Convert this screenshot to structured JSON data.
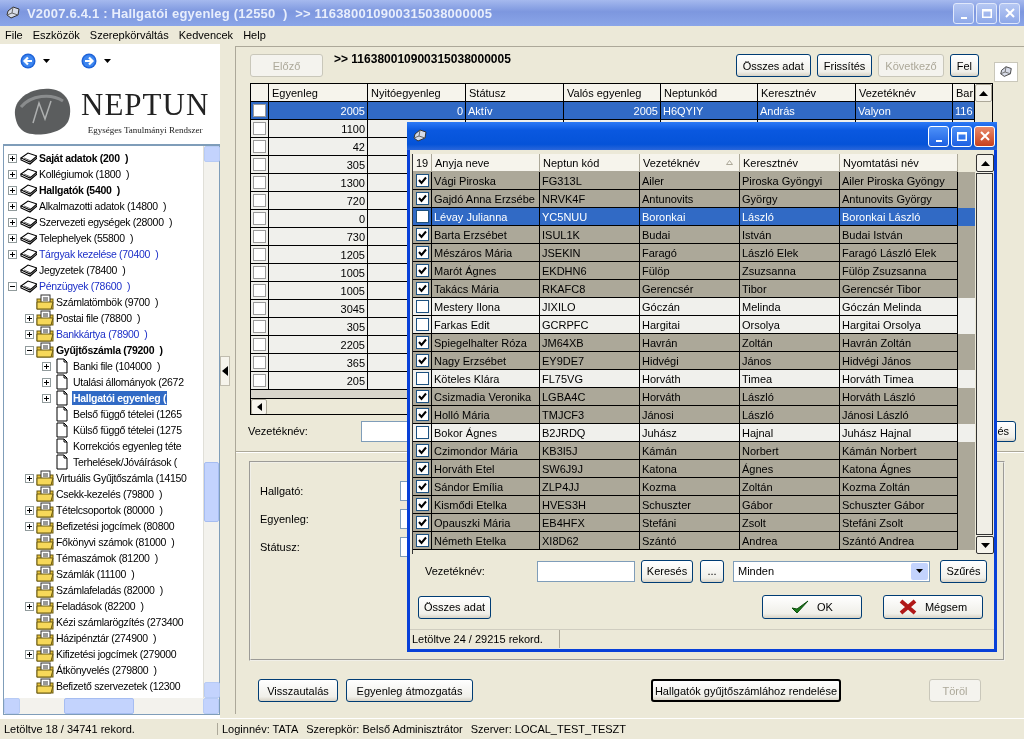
{
  "window": {
    "title": "V2007.6.4.1 : Hallgatói egyenleg (12550  )  >> 116380010900315038000005"
  },
  "menu": [
    "File",
    "Eszközök",
    "Szerepkörváltás",
    "Kedvencek",
    "Help"
  ],
  "logo": {
    "name": "NEPTUN",
    "tagline": "Egységes Tanulmányi Rendszer"
  },
  "tree": [
    {
      "label": "Saját adatok (200  )",
      "kind": "book",
      "bold": true,
      "selected": false,
      "expanded": false
    },
    {
      "label": "Kollégiumok (1800  )",
      "kind": "book",
      "bold": false,
      "selected": false,
      "expanded": false
    },
    {
      "label": "Hallgatók (5400  )",
      "kind": "book",
      "bold": true,
      "selected": false,
      "expanded": false
    },
    {
      "label": "Alkalmazotti adatok (14800  )",
      "kind": "book",
      "bold": false,
      "selected": false,
      "expanded": false
    },
    {
      "label": "Szervezeti egységek (28000  )",
      "kind": "book",
      "bold": false,
      "selected": false,
      "expanded": false
    },
    {
      "label": "Telephelyek (55800  )",
      "kind": "book",
      "bold": false,
      "selected": false,
      "expanded": false
    },
    {
      "label": "Tárgyak kezelése (70400  )",
      "kind": "book",
      "bold": false,
      "link": true,
      "selected": false,
      "expanded": false
    },
    {
      "label": "Jegyzetek (78400  )",
      "kind": "book",
      "bold": false,
      "selected": false
    },
    {
      "label": "Pénzügyek (78600  )",
      "kind": "book",
      "bold": false,
      "link": true,
      "selected": false,
      "expanded": true,
      "children": [
        {
          "label": "Számlatömbök (9700  )",
          "kind": "folder",
          "bold": false,
          "selected": false
        },
        {
          "label": "Postai file (78800  )",
          "kind": "folder",
          "bold": false,
          "selected": false,
          "expanded": false
        },
        {
          "label": "Bankkártya (78900  )",
          "kind": "folder",
          "bold": false,
          "link": true,
          "selected": false,
          "expanded": false
        },
        {
          "label": "Gyűjtőszámla (79200  )",
          "kind": "folder",
          "bold": true,
          "selected": false,
          "expanded": true,
          "children": [
            {
              "label": "Banki file (104000  )",
              "kind": "page",
              "bold": false,
              "selected": false,
              "expanded": false
            },
            {
              "label": "Utalási állományok (2672",
              "kind": "page",
              "bold": false,
              "selected": false,
              "expanded": false
            },
            {
              "label": "Hallgatói egyenleg (",
              "kind": "page",
              "bold": true,
              "selected": true,
              "expanded": false
            },
            {
              "label": "Belső függő tételei (1265",
              "kind": "page",
              "bold": false,
              "selected": false
            },
            {
              "label": "Külső függő tételei (1275",
              "kind": "page",
              "bold": false,
              "selected": false
            },
            {
              "label": "Korrekciós egyenleg téte",
              "kind": "page",
              "bold": false,
              "selected": false
            },
            {
              "label": "Terhelések/Jóváírások (",
              "kind": "page",
              "bold": false,
              "selected": false
            }
          ]
        },
        {
          "label": "Virtuális Gyűjtőszámla (14150",
          "kind": "folder",
          "bold": false,
          "selected": false,
          "expanded": false
        },
        {
          "label": "Csekk-kezelés (79800  )",
          "kind": "folder",
          "bold": false,
          "selected": false
        },
        {
          "label": "Tételcsoportok (80000  )",
          "kind": "folder",
          "bold": false,
          "selected": false,
          "expanded": false
        },
        {
          "label": "Befizetési jogcímek (80800",
          "kind": "folder",
          "bold": false,
          "selected": false,
          "expanded": false
        },
        {
          "label": "Főkönyvi számok (81000  )",
          "kind": "folder",
          "bold": false,
          "selected": false
        },
        {
          "label": "Témaszámok (81200  )",
          "kind": "folder",
          "bold": false,
          "selected": false
        },
        {
          "label": "Számlák (11100  )",
          "kind": "folder",
          "bold": false,
          "selected": false
        },
        {
          "label": "Számlafeladás (82000  )",
          "kind": "folder",
          "bold": false,
          "selected": false
        },
        {
          "label": "Feladások (82200  )",
          "kind": "folder",
          "bold": false,
          "selected": false,
          "expanded": false
        },
        {
          "label": "Kézi számlarögzítés (273400",
          "kind": "folder",
          "bold": false,
          "selected": false
        },
        {
          "label": "Házipénztár (274900  )",
          "kind": "folder",
          "bold": false,
          "selected": false
        },
        {
          "label": "Kifizetési jogcímek (279000",
          "kind": "folder",
          "bold": false,
          "selected": false,
          "expanded": false
        },
        {
          "label": "Átkönyvelés (279800  )",
          "kind": "folder",
          "bold": false,
          "selected": false
        },
        {
          "label": "Befizető szervezetek (12300",
          "kind": "folder",
          "bold": false,
          "selected": false
        }
      ]
    }
  ],
  "toolbar": {
    "prev": {
      "label": "Előző",
      "disabled": true
    },
    "path": ">> 116380010900315038000005",
    "buttons": [
      {
        "label": "Összes adat",
        "disabled": false
      },
      {
        "label": "Frissítés",
        "disabled": false
      },
      {
        "label": "Következő",
        "disabled": true
      },
      {
        "label": "Fel",
        "disabled": false
      }
    ]
  },
  "table": {
    "columns": [
      {
        "label": "Egyenleg",
        "numeric": true
      },
      {
        "label": "Nyitóegyenleg",
        "numeric": true
      },
      {
        "label": "Státusz",
        "numeric": false
      },
      {
        "label": "Valós egyenleg",
        "numeric": true
      },
      {
        "label": "Neptunkód",
        "numeric": false
      },
      {
        "label": "Keresztnév",
        "numeric": false
      },
      {
        "label": "Vezetéknév",
        "numeric": false
      },
      {
        "label": "Bar",
        "numeric": false
      }
    ],
    "rows": [
      {
        "checked": false,
        "selected": true,
        "cells": [
          "2005",
          "0",
          "Aktív",
          "2005",
          "H6QYIY",
          "András",
          "Valyon",
          "116"
        ]
      },
      {
        "checked": false,
        "selected": false,
        "cells": [
          "1100"
        ]
      },
      {
        "checked": false,
        "selected": false,
        "cells": [
          "42"
        ]
      },
      {
        "checked": false,
        "selected": false,
        "cells": [
          "305"
        ]
      },
      {
        "checked": false,
        "selected": false,
        "cells": [
          "1300"
        ]
      },
      {
        "checked": false,
        "selected": false,
        "cells": [
          "720"
        ]
      },
      {
        "checked": false,
        "selected": false,
        "cells": [
          "0"
        ]
      },
      {
        "checked": false,
        "selected": false,
        "cells": [
          "730"
        ]
      },
      {
        "checked": false,
        "selected": false,
        "cells": [
          "1205"
        ]
      },
      {
        "checked": false,
        "selected": false,
        "cells": [
          "1005"
        ]
      },
      {
        "checked": false,
        "selected": false,
        "cells": [
          "1005"
        ]
      },
      {
        "checked": false,
        "selected": false,
        "cells": [
          "3045"
        ]
      },
      {
        "checked": false,
        "selected": false,
        "cells": [
          "305"
        ]
      },
      {
        "checked": false,
        "selected": false,
        "cells": [
          "2205"
        ]
      },
      {
        "checked": false,
        "selected": false,
        "cells": [
          "365"
        ]
      },
      {
        "checked": false,
        "selected": false,
        "cells": [
          "205"
        ]
      }
    ]
  },
  "filter": {
    "label": "Vezetéknév:",
    "button": "és"
  },
  "details": [
    {
      "label": "Hallgató:"
    },
    {
      "label": "Egyenleg:"
    },
    {
      "label": "Státusz:"
    }
  ],
  "actions": [
    {
      "label": "Visszautalás",
      "disabled": false,
      "default": false
    },
    {
      "label": "Egyenleg átmozgatás",
      "disabled": false,
      "default": false
    },
    {
      "label": "Hallgatók gyűjtőszámlához rendelése",
      "disabled": false,
      "default": true
    },
    {
      "label": "Töröl",
      "disabled": true,
      "default": false
    }
  ],
  "status_bar": [
    "Letöltve 18 / 34741 rekord.",
    "Loginnév: TATA",
    "Szerepkör: Belső Adminisztrátor",
    "Szerver: LOCAL_TEST_TESZT"
  ],
  "dialog": {
    "count": "19",
    "columns": [
      {
        "label": "Anyja neve",
        "sorted": false
      },
      {
        "label": "Neptun kód",
        "sorted": false
      },
      {
        "label": "Vezetéknév",
        "sorted": true
      },
      {
        "label": "Keresztnév",
        "sorted": false
      },
      {
        "label": "Nyomtatási név",
        "sorted": false
      }
    ],
    "rows": [
      {
        "checked": true,
        "selected": false,
        "cells": [
          "Vági Piroska",
          "FG313L",
          "Ailer",
          "Piroska Gyöngyi",
          "Ailer Piroska Gyöngy"
        ]
      },
      {
        "checked": true,
        "selected": false,
        "cells": [
          "Gajdó Anna Erzsébe",
          "NRVK4F",
          "Antunovits",
          "György",
          "Antunovits György"
        ]
      },
      {
        "checked": false,
        "selected": true,
        "cells": [
          "Lévay Julianna",
          "YC5NUU",
          "Boronkai",
          "László",
          "Boronkai László"
        ]
      },
      {
        "checked": true,
        "selected": false,
        "cells": [
          "Barta Erzsébet",
          "ISUL1K",
          "Budai",
          "István",
          "Budai István"
        ]
      },
      {
        "checked": true,
        "selected": false,
        "cells": [
          "Mészáros Mária",
          "JSEKIN",
          "Faragó",
          "László Elek",
          "Faragó László Elek"
        ]
      },
      {
        "checked": true,
        "selected": false,
        "cells": [
          "Marót Ágnes",
          "EKDHN6",
          "Fülöp",
          "Zsuzsanna",
          "Fülöp Zsuzsanna"
        ]
      },
      {
        "checked": true,
        "selected": false,
        "cells": [
          "Takács Mária",
          "RKAFC8",
          "Gerencsér",
          "Tibor",
          "Gerencsér Tibor"
        ]
      },
      {
        "checked": false,
        "selected": false,
        "cells": [
          "Mestery Ilona",
          "JIXILO",
          "Góczán",
          "Melinda",
          "Góczán Melinda"
        ]
      },
      {
        "checked": false,
        "selected": false,
        "cells": [
          "Farkas Edit",
          "GCRPFC",
          "Hargitai",
          "Orsolya",
          "Hargitai Orsolya"
        ]
      },
      {
        "checked": true,
        "selected": false,
        "cells": [
          "Spiegelhalter Róza",
          "JM64XB",
          "Havrán",
          "Zoltán",
          "Havrán Zoltán"
        ]
      },
      {
        "checked": true,
        "selected": false,
        "cells": [
          "Nagy Erzsébet",
          "EY9DE7",
          "Hidvégi",
          "János",
          "Hidvégi János"
        ]
      },
      {
        "checked": false,
        "selected": false,
        "cells": [
          "Köteles Klára",
          "FL75VG",
          "Horváth",
          "Timea",
          "Horváth Timea"
        ]
      },
      {
        "checked": true,
        "selected": false,
        "cells": [
          "Csizmadia Veronika",
          "LGBA4C",
          "Horváth",
          "László",
          "Horváth László"
        ]
      },
      {
        "checked": true,
        "selected": false,
        "cells": [
          "Holló Mária",
          "TMJCF3",
          "Jánosi",
          "László",
          "Jánosi László"
        ]
      },
      {
        "checked": false,
        "selected": false,
        "cells": [
          "Bokor Ágnes",
          "B2JRDQ",
          "Juhász",
          "Hajnal",
          "Juhász Hajnal"
        ]
      },
      {
        "checked": true,
        "selected": false,
        "cells": [
          "Czimondor Mária",
          "KB3I5J",
          "Kámán",
          "Norbert",
          "Kámán Norbert"
        ]
      },
      {
        "checked": true,
        "selected": false,
        "cells": [
          "Horváth Etel",
          "SW6J9J",
          "Katona",
          "Ágnes",
          "Katona Ágnes"
        ]
      },
      {
        "checked": true,
        "selected": false,
        "cells": [
          "Sándor Emília",
          "ZLP4JJ",
          "Kozma",
          "Zoltán",
          "Kozma Zoltán"
        ]
      },
      {
        "checked": true,
        "selected": false,
        "cells": [
          "Kismődi Etelka",
          "HVES3H",
          "Schuszter",
          "Gábor",
          "Schuszter Gábor"
        ]
      },
      {
        "checked": true,
        "selected": false,
        "cells": [
          "Opauszki Mária",
          "EB4HFX",
          "Stefáni",
          "Zsolt",
          "Stefáni Zsolt"
        ]
      },
      {
        "checked": true,
        "selected": false,
        "cells": [
          "Németh Etelka",
          "XI8D62",
          "Szántó",
          "Andrea",
          "Szántó Andrea"
        ]
      }
    ],
    "filter": {
      "label": "Vezetéknév:",
      "search": "Keresés",
      "more": "...",
      "select": "Minden",
      "apply": "Szűrés"
    },
    "buttons": [
      {
        "label": "Összes adat",
        "kind": "plain"
      },
      {
        "label": "OK",
        "kind": "ok"
      },
      {
        "label": "Mégsem",
        "kind": "cancel"
      }
    ],
    "status": "Letöltve 24 / 29215 rekord."
  }
}
